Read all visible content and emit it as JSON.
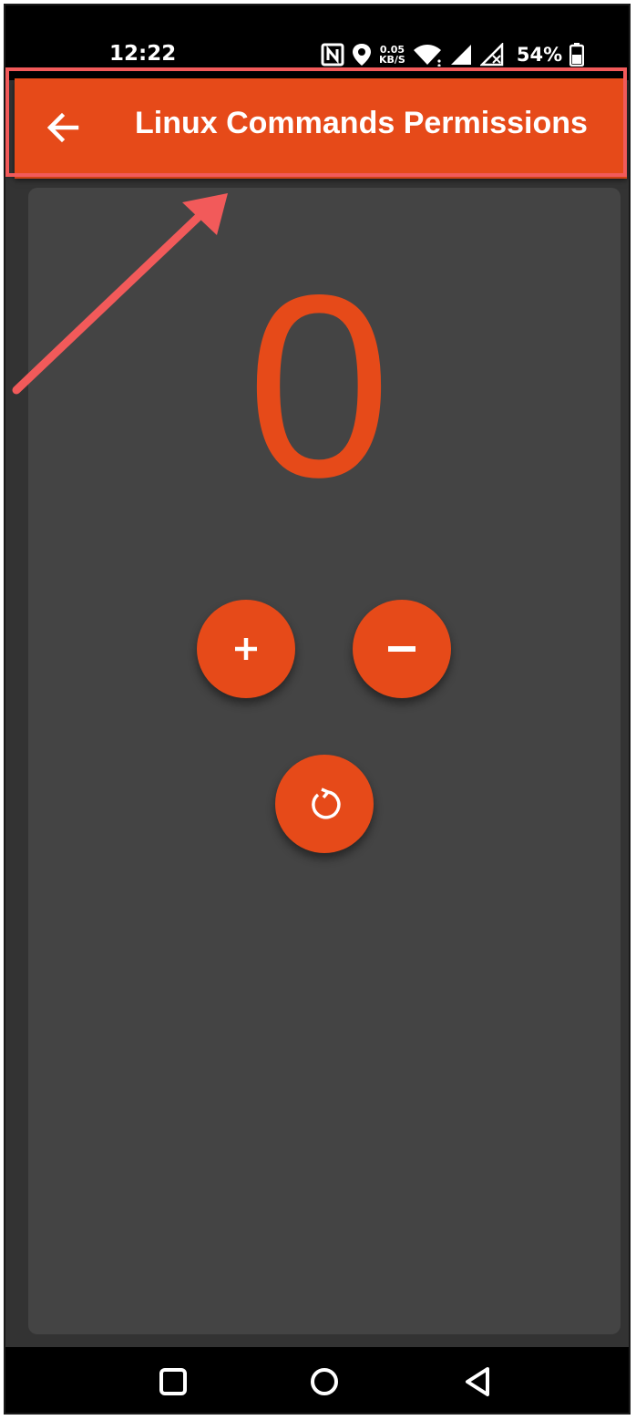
{
  "status_bar": {
    "time": "12:22",
    "net_speed_value": "0.05",
    "net_speed_unit": "KB/S",
    "battery": "54%",
    "icons": [
      "nfc-icon",
      "location-icon",
      "wifi-icon",
      "signal-icon",
      "signal-no-data-icon",
      "battery-icon"
    ]
  },
  "app_bar": {
    "title": "Linux Commands Permissions",
    "back_icon": "arrow-back-icon",
    "color": "#e64a19"
  },
  "counter": {
    "value": "0",
    "color": "#e64a19"
  },
  "buttons": {
    "increment_icon": "plus-icon",
    "decrement_icon": "minus-icon",
    "reset_icon": "refresh-icon"
  },
  "nav_bar": {
    "icons": [
      "recents-icon",
      "home-icon",
      "back-icon"
    ]
  },
  "annotation": {
    "highlight_color": "#f25a5a"
  }
}
